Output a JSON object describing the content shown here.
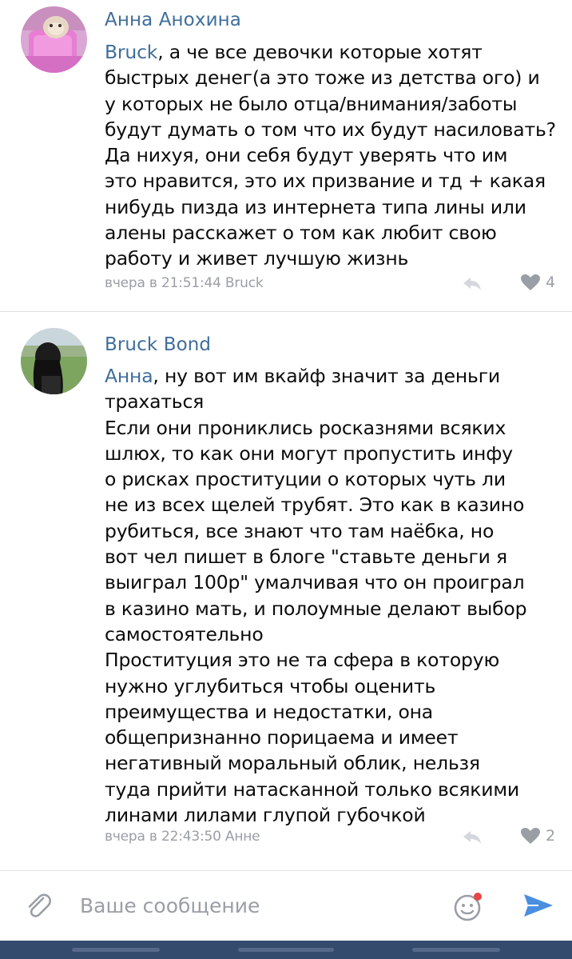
{
  "comments": [
    {
      "author": "Анна Анохина",
      "mention": "Bruck",
      "text": ", а че все девочки которые хотят\nбыстрых денег(а это тоже из детства ого) и\nу которых не было отца/внимания/заботы\nбудут думать о том что их будут насиловать?\nДа нихуя, они себя будут уверять что им\nэто нравится, это их призвание и тд + какая\nнибудь пизда из интернета типа лины или\nалены расскажет о том как любит свою\nработу и живет лучшую жизнь",
      "meta": "вчера в 21:51:44 Bruck",
      "likes": "4"
    },
    {
      "author": "Bruck Bond",
      "mention": "Анна",
      "text": ", ну вот им вкайф значит за деньги\nтрахаться\nЕсли они прониклись росказнями всяких\nшлюх, то как они могут пропустить инфу\nо рисках проституции о которых чуть ли\nне из всех щелей трубят. Это как в казино\nрубиться, все знают что там наёбка, но\nвот чел пишет в блоге \"ставьте деньги я\nвыиграл 100р\" умалчивая что он проиграл\nв казино мать, и полоумные делают выбор\nсамостоятельно\nПроституция это не та сфера в которую\nнужно углубиться чтобы оценить\nпреимущества и недостатки, она\nобщепризнанно порицаема и имеет\nнегативный моральный облик, нельзя\nтуда прийти натасканной только всякими\nлинами лилами глупой губочкой",
      "meta": "вчера в 22:43:50 Анне",
      "likes": "2"
    }
  ],
  "composer": {
    "placeholder": "Ваше сообщение"
  },
  "icons": {
    "attach": "paperclip-icon",
    "emoji": "emoji-icon",
    "send": "send-icon",
    "reply": "reply-icon",
    "like": "heart-icon"
  },
  "colors": {
    "link": "#3f6e9b",
    "meta": "#9a9ea5",
    "send": "#4a8ee0",
    "navbar": "#344b6d",
    "notification_dot": "#e64646"
  }
}
